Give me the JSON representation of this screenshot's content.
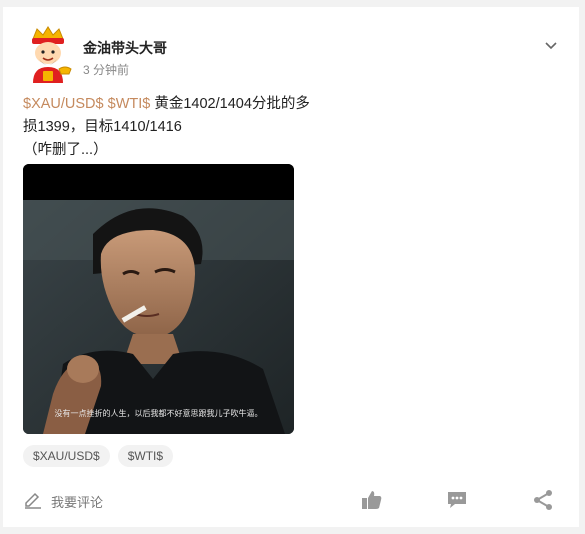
{
  "post": {
    "author": "金油带头大哥",
    "time": "3 分钟前",
    "tag1": "$XAU/USD$",
    "tag2": "$WTI$",
    "line1_rest": " 黄金1402/1404分批的多",
    "line2": "损1399，目标1410/1416",
    "line3": "（咋删了...）",
    "image_caption": "没有一点挫折的人生，以后我都不好意思跟我儿子吹牛逼。"
  },
  "tags": [
    "$XAU/USD$",
    "$WTI$"
  ],
  "actions": {
    "comment_label": "我要评论"
  },
  "colors": {
    "tag_color": "#c58a5e",
    "icon_color": "#999999"
  },
  "icons": {
    "menu": "chevron-down-icon",
    "comment": "pen-icon",
    "like": "thumbs-up-icon",
    "reply": "speech-bubble-icon",
    "share": "share-icon"
  }
}
